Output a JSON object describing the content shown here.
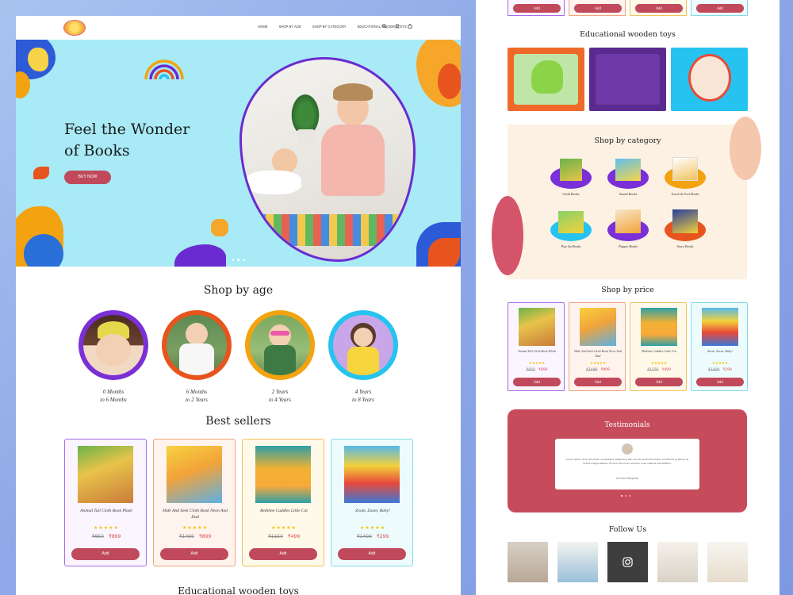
{
  "nav": {
    "items": [
      "HOME",
      "SHOP BY AGE",
      "SHOP BY CATEGORY",
      "EDUCATIONAL WOODEN TOYS"
    ],
    "icons": [
      "search-icon",
      "user-icon",
      "cart-icon"
    ]
  },
  "hero": {
    "title_line1": "Feel the Wonder",
    "title_line2": "of Books",
    "button": "BUY NOW"
  },
  "shop_by_age": {
    "title": "Shop by age",
    "items": [
      {
        "line1": "0 Months",
        "line2": "to 6 Months",
        "ring": "#7b2fd6"
      },
      {
        "line1": "6 Months",
        "line2": "to 2 Years",
        "ring": "#e8541e"
      },
      {
        "line1": "2 Years",
        "line2": "to 4 Years",
        "ring": "#f2a30f"
      },
      {
        "line1": "4 Years",
        "line2": "to 8 Years",
        "ring": "#27c3f0"
      }
    ]
  },
  "best_sellers": {
    "title": "Best sellers",
    "items": [
      {
        "name": "Animal Tail Cloth Book Plush",
        "stars": "★★★★★",
        "old": "₹850",
        "new": "₹899",
        "add": "Add"
      },
      {
        "name": "Hide And Seek Cloth Book Neon And Dad",
        "stars": "★★★★★",
        "old": "₹1490",
        "new": "₹899",
        "add": "Add"
      },
      {
        "name": "Bedtime Cuddles Little Cat",
        "stars": "★★★★★",
        "old": "₹1150",
        "new": "₹499",
        "add": "Add"
      },
      {
        "name": "Zoom, Zoom, Baby!",
        "stars": "★★★★★",
        "old": "₹1400",
        "new": "₹299",
        "add": "Add"
      }
    ]
  },
  "next_section_peek": "Educational wooden toys",
  "right": {
    "top_add_buttons": [
      "Add",
      "Add",
      "Add",
      "Add"
    ],
    "wooden_title": "Educational wooden toys",
    "category_title": "Shop by category",
    "categories": [
      "Cloth Books",
      "Sound Books",
      "Touch & Feel Books",
      "Pop Up Books",
      "Puppet Books",
      "Story Books"
    ],
    "price_title": "Shop by price",
    "price_items": [
      {
        "name": "Animal Tail Cloth Book Plush",
        "stars": "★★★★★",
        "old": "₹850",
        "new": "₹899",
        "add": "Add"
      },
      {
        "name": "Hide And Seek Cloth Book Neon And Dad",
        "stars": "★★★★★",
        "old": "₹1490",
        "new": "₹899",
        "add": "Add"
      },
      {
        "name": "Bedtime Cuddles Little Cat",
        "stars": "★★★★★",
        "old": "₹1150",
        "new": "₹499",
        "add": "Add"
      },
      {
        "name": "Zoom, Zoom, Baby!",
        "stars": "★★★★★",
        "old": "₹1400",
        "new": "₹299",
        "add": "Add"
      }
    ],
    "testimonials_title": "Testimonials",
    "testimonial_text": "Lorem ipsum dolor sit amet, consectetur adipiscing elit, sed do eiusmod tempor incididunt ut labore et dolore magna aliqua. Ut enim ad minim veniam, quis nostrud exercitation.",
    "testimonial_author": "Sandra Delgado",
    "follow_title": "Follow Us"
  },
  "colors": {
    "accent": "#c04a5b",
    "hero_bg": "#a8eaf6",
    "purple": "#6a2bd0"
  }
}
